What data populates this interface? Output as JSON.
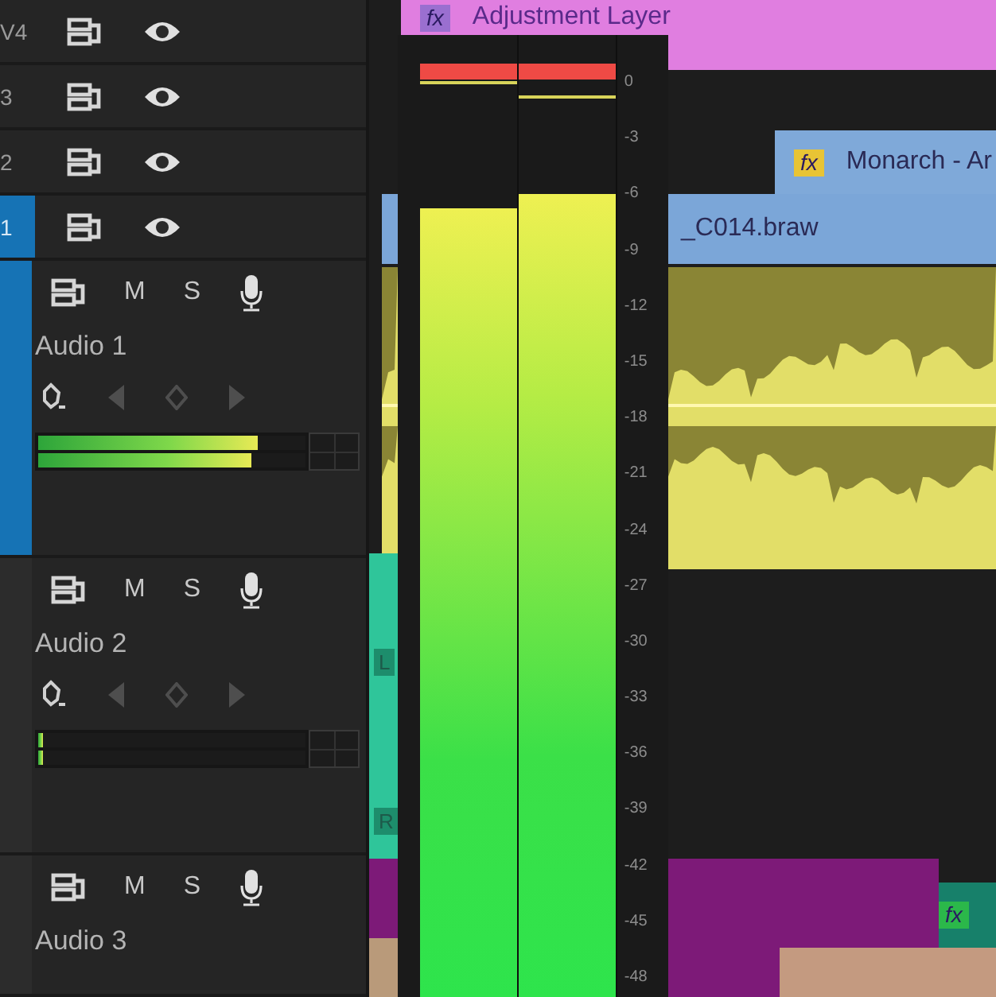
{
  "video_tracks": [
    {
      "label": "V4",
      "targeted": false
    },
    {
      "label": "3",
      "targeted": false
    },
    {
      "label": "2",
      "targeted": false
    },
    {
      "label": "1",
      "targeted": true
    }
  ],
  "audio_tracks": [
    {
      "name": "Audio 1",
      "targeted": true,
      "mute": "M",
      "solo": "S",
      "channels": [
        {
          "level": 0.82
        },
        {
          "level": 0.8
        }
      ]
    },
    {
      "name": "Audio 2",
      "targeted": false,
      "mute": "M",
      "solo": "S",
      "channels": [
        {
          "level": 0.02
        },
        {
          "level": 0.02
        }
      ]
    },
    {
      "name": "Audio 3",
      "targeted": false,
      "mute": "M",
      "solo": "S"
    }
  ],
  "clips": [
    {
      "kind": "video",
      "label": "Adjustment Layer",
      "badge": "fx",
      "color": "#e07ee0"
    },
    {
      "kind": "video",
      "color": "#e07ee0"
    },
    {
      "kind": "video",
      "label": "Monarch - Ar",
      "badge": "fx",
      "color": "#7fa9d9"
    },
    {
      "kind": "video",
      "color": "#7ba6d8"
    },
    {
      "kind": "video",
      "label": "_C014.braw",
      "color": "#7ba6d8"
    },
    {
      "kind": "waveform",
      "color": "#e2de68"
    },
    {
      "kind": "waveform",
      "color": "#e2de68"
    },
    {
      "kind": "stereo",
      "channel_labels": [
        "L",
        "R"
      ],
      "color": "#2fc59a"
    },
    {
      "kind": "video",
      "color": "#7d1a78"
    },
    {
      "kind": "video",
      "color": "#b99a7a"
    },
    {
      "kind": "video",
      "color": "#7d1a78"
    },
    {
      "kind": "video",
      "color": "#7d1a78"
    },
    {
      "kind": "video",
      "badge": "fx",
      "color": "#17806a"
    },
    {
      "kind": "video",
      "color": "#c49a80"
    }
  ],
  "meter": {
    "scale": [
      "0",
      "-3",
      "-6",
      "-9",
      "-12",
      "-15",
      "-18",
      "-21",
      "-24",
      "-27",
      "-30",
      "-33",
      "-36",
      "-39",
      "-42",
      "-45",
      "-48"
    ],
    "channels": [
      {
        "level": 0.86,
        "peak_hold": {
          "level": 0.995
        },
        "clipped": true
      },
      {
        "level": 0.875,
        "peak_hold": {
          "level": 0.98
        },
        "clipped": true
      }
    ]
  }
}
